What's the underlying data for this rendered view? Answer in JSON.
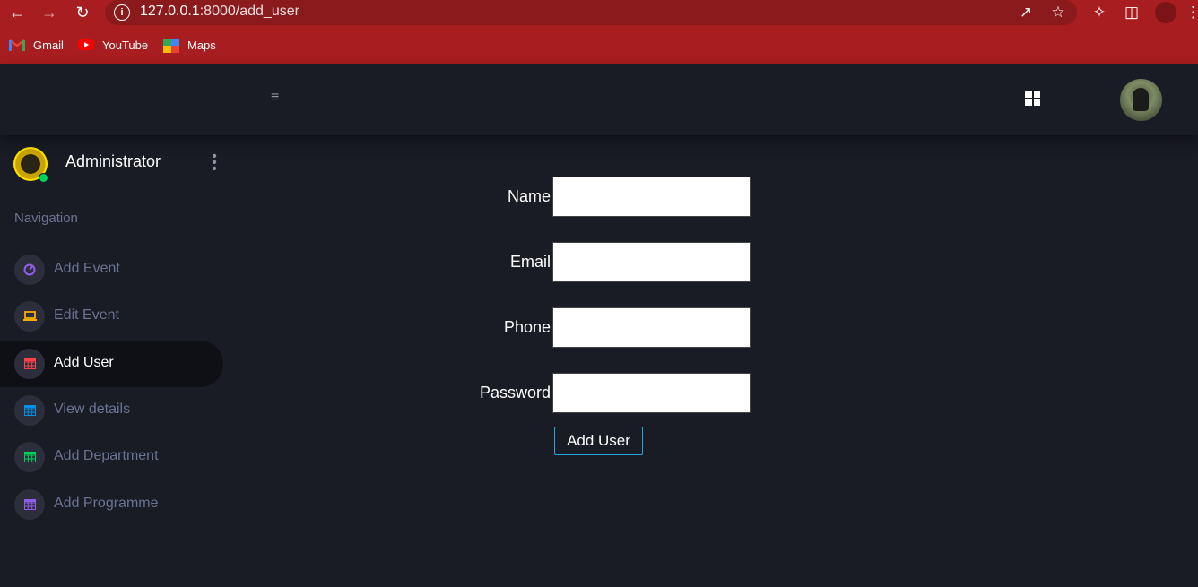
{
  "browser": {
    "url_host": "127.0.0.1",
    "url_path": ":8000/add_user",
    "bookmarks": [
      {
        "label": "Gmail"
      },
      {
        "label": "YouTube"
      },
      {
        "label": "Maps"
      }
    ]
  },
  "sidebar": {
    "user_name": "Administrator",
    "nav_title": "Navigation",
    "items": [
      {
        "label": "Add Event",
        "icon": "speedometer-icon",
        "color": "#8f5fe8"
      },
      {
        "label": "Edit Event",
        "icon": "laptop-icon",
        "color": "#ffab00"
      },
      {
        "label": "Add User",
        "icon": "table-icon",
        "color": "#fc424a"
      },
      {
        "label": "View details",
        "icon": "table-icon",
        "color": "#0090e7"
      },
      {
        "label": "Add Department",
        "icon": "table-icon",
        "color": "#00d25b"
      },
      {
        "label": "Add Programme",
        "icon": "table-icon",
        "color": "#8f5fe8"
      }
    ],
    "active_index": 2
  },
  "form": {
    "name_label": "Name",
    "email_label": "Email",
    "phone_label": "Phone",
    "password_label": "Password",
    "name_value": "",
    "email_value": "",
    "phone_value": "",
    "password_value": "",
    "submit_label": "Add User"
  },
  "colors": {
    "background": "#191c24",
    "browser_chrome": "#a81d1f",
    "button_border": "#1ea6e7"
  }
}
